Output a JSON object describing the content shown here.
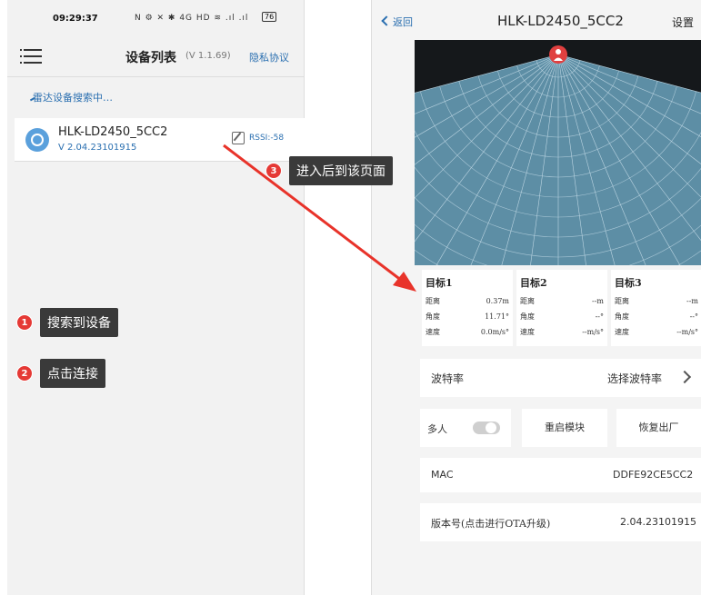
{
  "left_phone": {
    "status_bar": {
      "time": "09:29:37",
      "icons_text": "N ⚙ ✕ ✱ 4G HD ≋ .ıl .ıl",
      "battery": "76"
    },
    "header": {
      "title": "设备列表",
      "version": "(V 1.1.69)",
      "privacy_link": "隐私协议"
    },
    "search_status": "雷达设备搜索中…",
    "device": {
      "name": "HLK-LD2450_5CC2",
      "version": "V 2.04.23101915",
      "rssi": "RSSI:-58"
    }
  },
  "annotations": [
    {
      "number": "1",
      "text": "搜索到设备"
    },
    {
      "number": "2",
      "text": "点击连接"
    },
    {
      "number": "3",
      "text": "进入后到该页面"
    }
  ],
  "right_phone": {
    "header": {
      "back_label": "返回",
      "title": "HLK-LD2450_5CC2",
      "settings_label": "设置"
    },
    "targets": [
      {
        "title": "目标1",
        "distance_label": "距离",
        "distance": "0.37m",
        "angle_label": "角度",
        "angle": "11.71°",
        "speed_label": "速度",
        "speed": "0.0m/s°"
      },
      {
        "title": "目标2",
        "distance_label": "距离",
        "distance": "--m",
        "angle_label": "角度",
        "angle": "--°",
        "speed_label": "速度",
        "speed": "--m/s°"
      },
      {
        "title": "目标3",
        "distance_label": "距离",
        "distance": "--m",
        "angle_label": "角度",
        "angle": "--°",
        "speed_label": "速度",
        "speed": "--m/s°"
      }
    ],
    "baud_rate": {
      "label": "波特率",
      "value": "选择波特率"
    },
    "multi_person": {
      "label": "多人",
      "enabled": false
    },
    "restart_button": "重启模块",
    "factory_reset_button": "恢复出厂",
    "mac": {
      "label": "MAC",
      "value": "DDFE92CE5CC2"
    },
    "firmware": {
      "label": "版本号(点击进行OTA升级)",
      "value": "2.04.23101915"
    }
  },
  "colors": {
    "accent_blue": "#2a6fb0",
    "annotation_red": "#e53935",
    "arrow_red": "#e8332a",
    "radar_fill": "#5d8ea5"
  }
}
